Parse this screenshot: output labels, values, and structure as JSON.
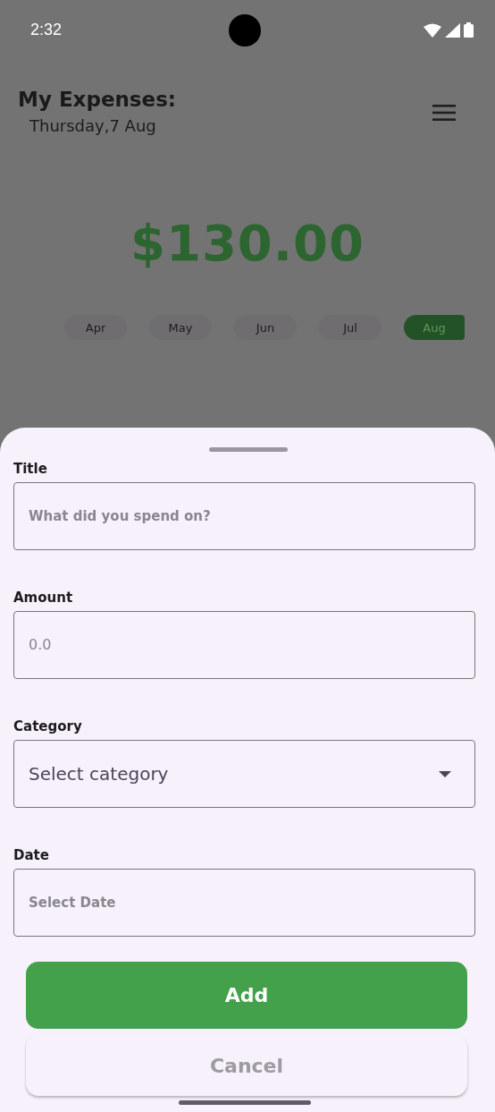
{
  "status_bar": {
    "time": "2:32"
  },
  "header": {
    "title": "My Expenses:",
    "date": "Thursday,7 Aug"
  },
  "total": "$130.00",
  "months": [
    {
      "label": "Apr",
      "selected": false
    },
    {
      "label": "May",
      "selected": false
    },
    {
      "label": "Jun",
      "selected": false
    },
    {
      "label": "Jul",
      "selected": false
    },
    {
      "label": "Aug",
      "selected": true
    }
  ],
  "sheet": {
    "fields": [
      {
        "label": "Title",
        "kind": "text",
        "placeholder": "What did you spend on?"
      },
      {
        "label": "Amount",
        "kind": "number",
        "placeholder": "0.0"
      },
      {
        "label": "Category",
        "kind": "dropdown",
        "placeholder": "Select category"
      },
      {
        "label": "Date",
        "kind": "date",
        "placeholder": "Select Date"
      }
    ],
    "buttons": [
      {
        "label": "Add",
        "kind": "primary"
      },
      {
        "label": "Cancel",
        "kind": "secondary"
      }
    ]
  }
}
